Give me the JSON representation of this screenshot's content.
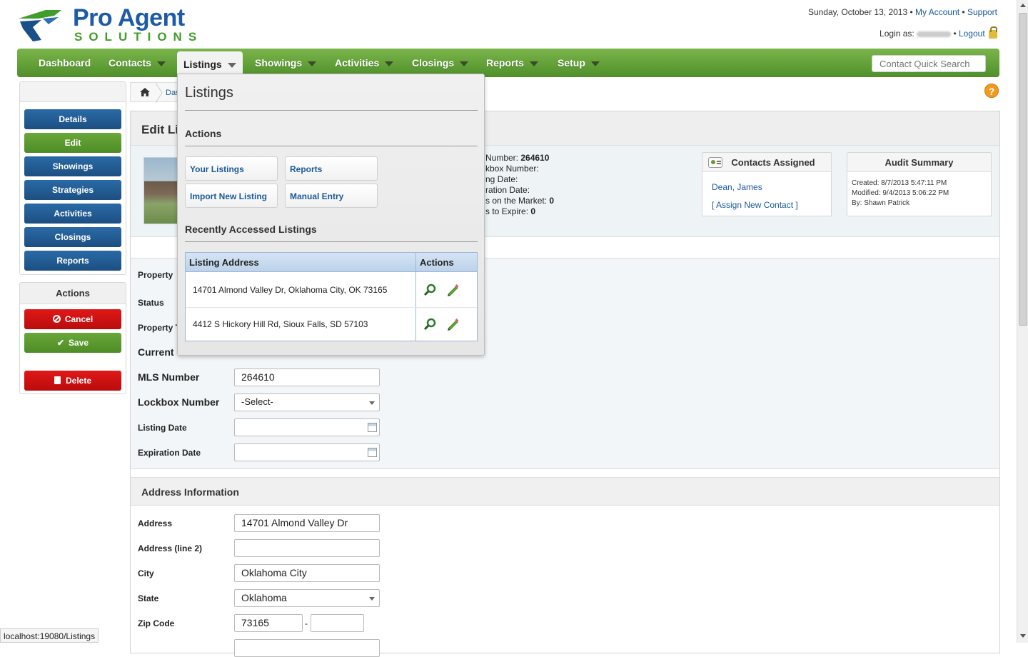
{
  "brand": {
    "line1": "Pro Agent",
    "line2": "SOLUTIONS"
  },
  "header": {
    "date": "Sunday, October 13, 2013",
    "sep": "•",
    "my_account": "My Account",
    "support": "Support",
    "login_label": "Login as:",
    "logout": "Logout"
  },
  "nav": {
    "items": [
      "Dashboard",
      "Contacts",
      "Listings",
      "Showings",
      "Activities",
      "Closings",
      "Reports",
      "Setup"
    ],
    "quick_search_placeholder": "Contact Quick Search"
  },
  "sidebar": {
    "buttons": [
      "Details",
      "Edit",
      "Showings",
      "Strategies",
      "Activities",
      "Closings",
      "Reports"
    ],
    "actions_title": "Actions",
    "cancel": "Cancel",
    "save": "Save",
    "delete": "Delete"
  },
  "breadcrumb": {
    "text": "Das"
  },
  "help": "?",
  "edit": {
    "title": "Edit Li",
    "prop_info": [
      {
        "label": "Number: ",
        "value": "264610"
      },
      {
        "label": "kbox Number:",
        "value": ""
      },
      {
        "label": "ng Date:",
        "value": ""
      },
      {
        "label": "ration Date:",
        "value": ""
      },
      {
        "label": "s on the Market: ",
        "value": "0"
      },
      {
        "label": "s to Expire: ",
        "value": "0"
      }
    ],
    "contacts_card": {
      "title": "Contacts Assigned",
      "contact": "Dean, James",
      "assign": "[ Assign New Contact ]"
    },
    "audit_card": {
      "title": "Audit Summary",
      "created": "Created: 8/7/2013 5:47:11 PM",
      "modified": "Modified: 9/4/2013 5:06:22 PM",
      "by": "By: Shawn Patrick"
    }
  },
  "form": {
    "property_label1": "Property",
    "status_label": "Status",
    "property_label2": "Property T",
    "current_label": "Current",
    "mls_label": "MLS Number",
    "mls_value": "264610",
    "lockbox_label": "Lockbox Number",
    "lockbox_value": "-Select-",
    "listing_date_label": "Listing Date",
    "expiration_label": "Expiration Date"
  },
  "address": {
    "section_title": "Address Information",
    "address_label": "Address",
    "address_value": "14701 Almond Valley Dr",
    "address2_label": "Address (line 2)",
    "city_label": "City",
    "city_value": "Oklahoma City",
    "state_label": "State",
    "state_value": "Oklahoma",
    "zip_label": "Zip Code",
    "zip_value": "73165",
    "zip_dash": "-"
  },
  "dropdown": {
    "title": "Listings",
    "actions_title": "Actions",
    "buttons": [
      "Your Listings",
      "Reports",
      "Import New Listing",
      "Manual Entry"
    ],
    "recent_title": "Recently Accessed Listings",
    "col_address": "Listing Address",
    "col_actions": "Actions",
    "rows": [
      "14701 Almond Valley Dr, Oklahoma City, OK 73165",
      "4412 S Hickory Hill Rd, Sioux Falls, SD 57103"
    ]
  },
  "status_bar": "localhost:19080/Listings",
  "colors": {
    "nav_green": "#5f9e35",
    "button_blue": "#1c4f82",
    "button_green": "#4e8c26",
    "button_red": "#c41010",
    "link_blue": "#1a5a9c"
  }
}
